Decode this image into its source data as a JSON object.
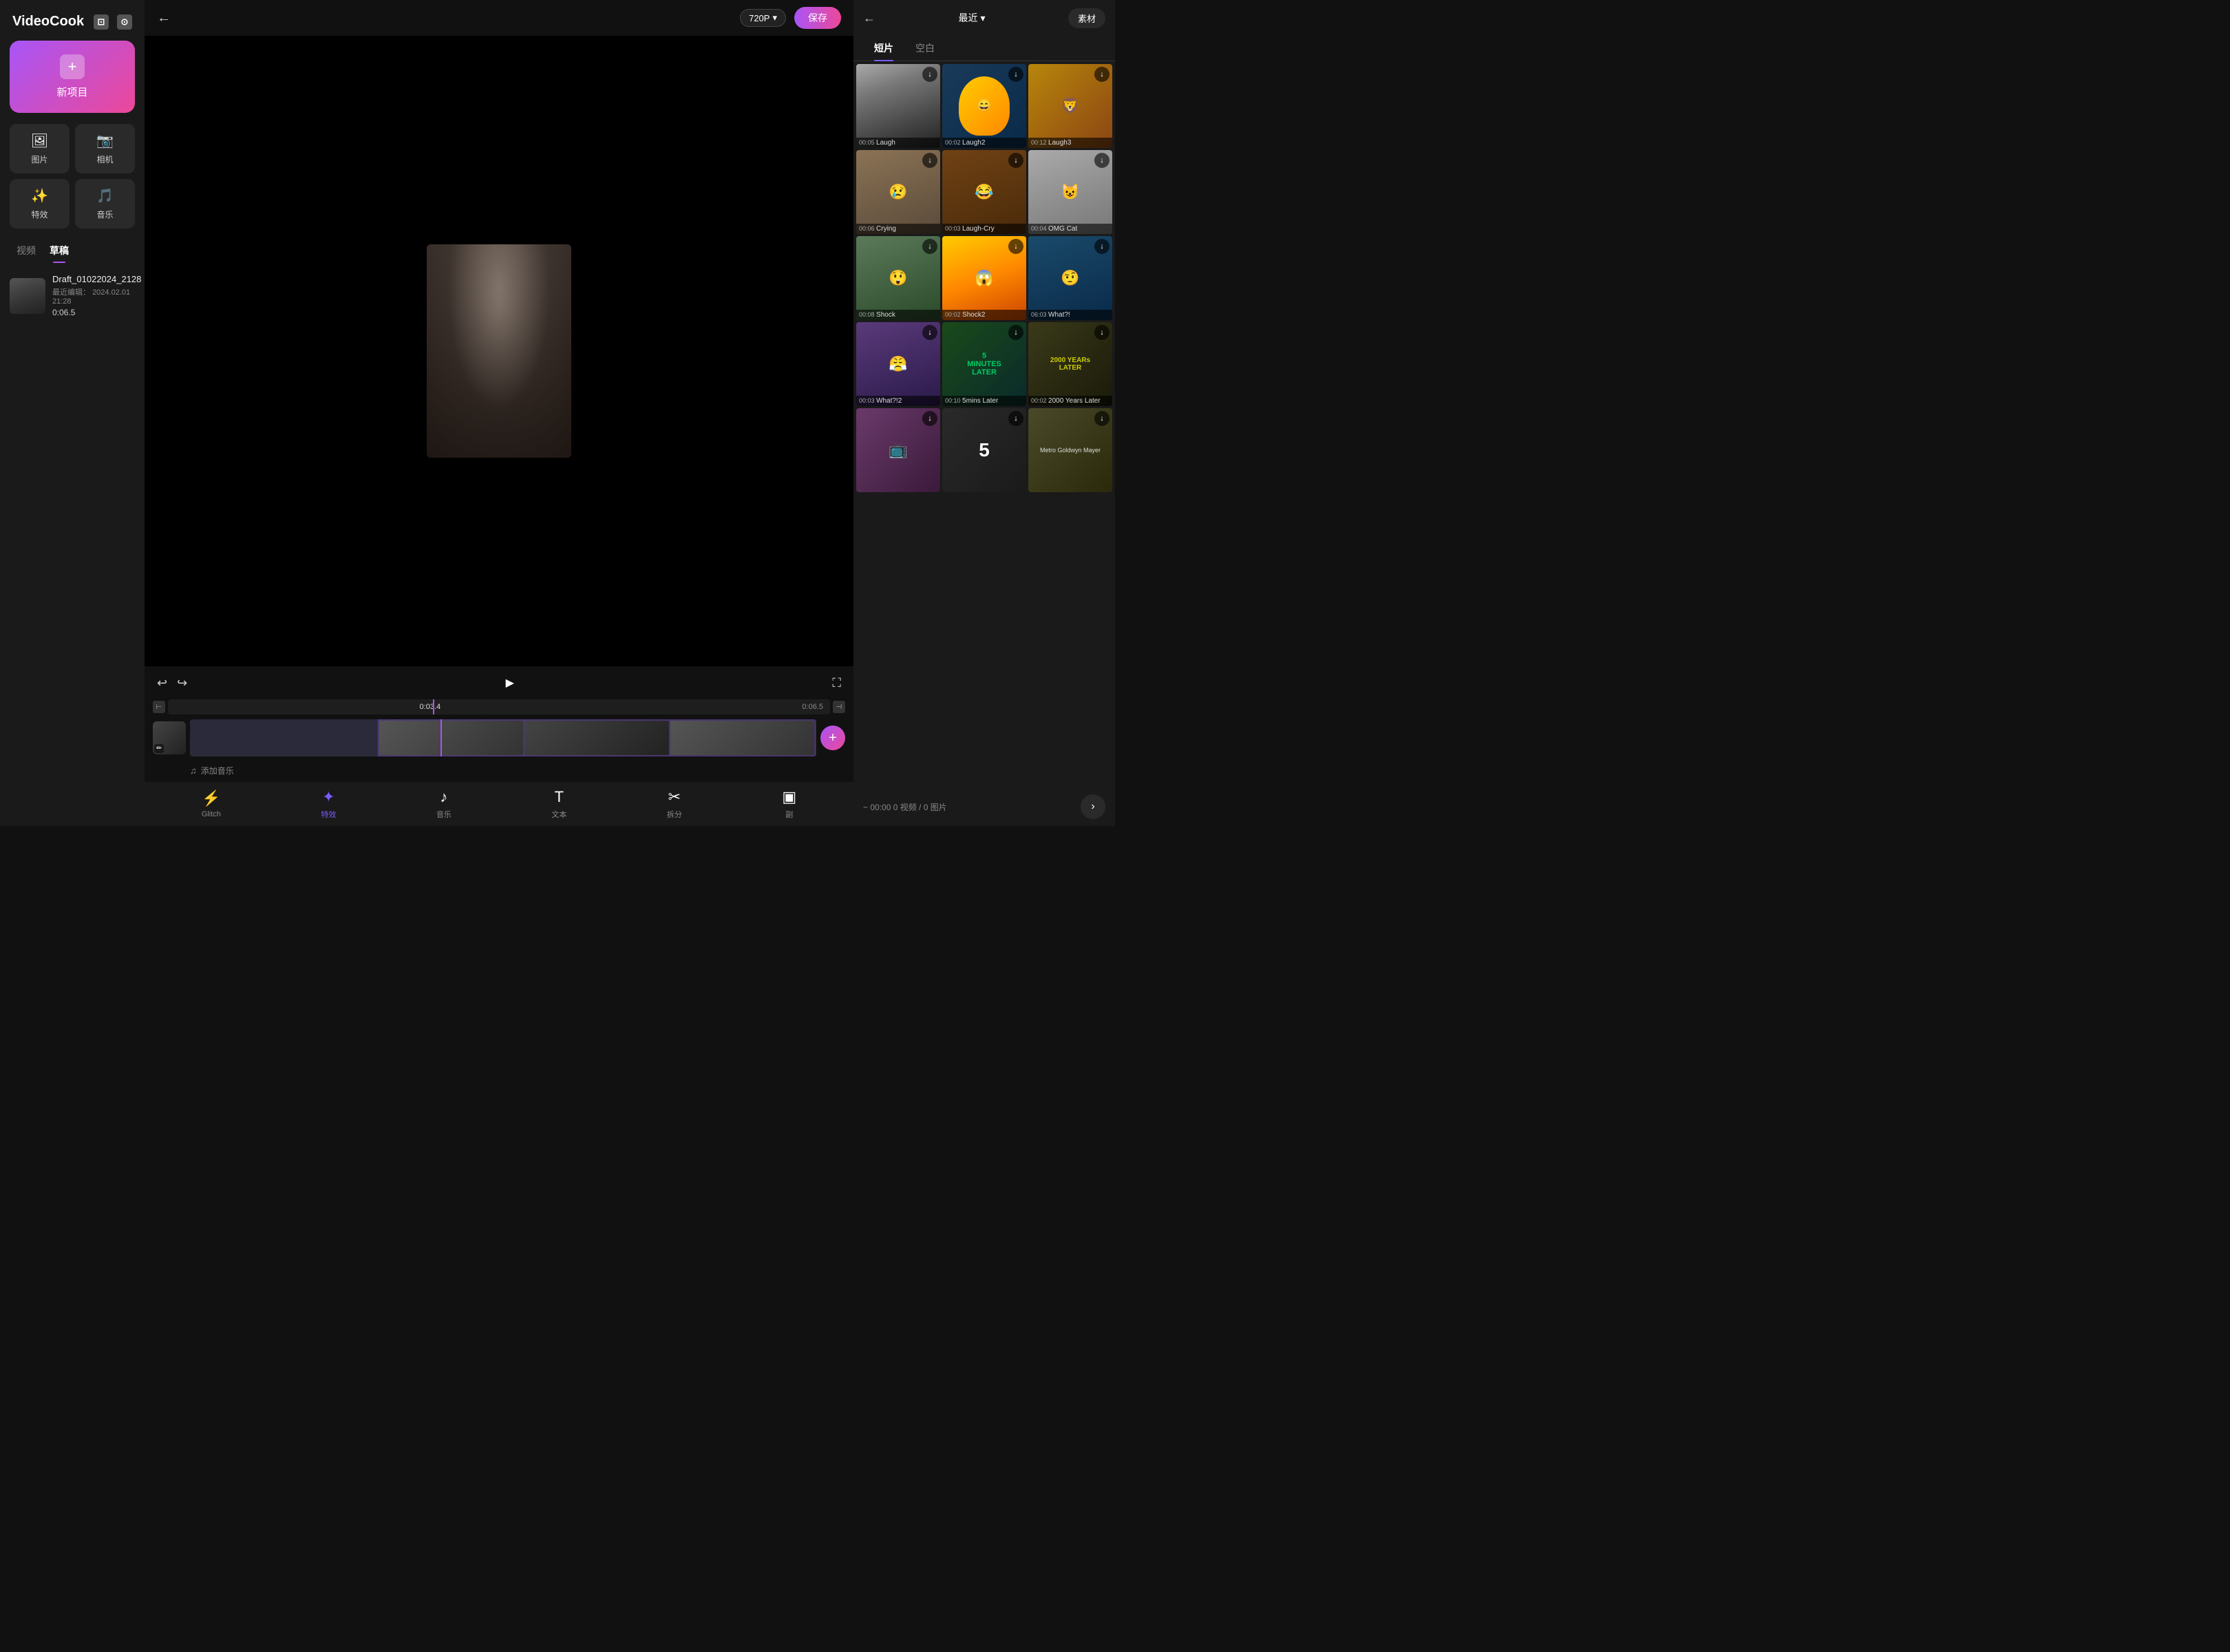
{
  "app": {
    "name": "VideoCook"
  },
  "sidebar": {
    "logo": "VideoCook",
    "icons": [
      "tv-icon",
      "camera-icon"
    ],
    "new_project_label": "新项目",
    "quick_actions": [
      {
        "icon": "🖼",
        "label": "图片"
      },
      {
        "icon": "📷",
        "label": "相机"
      },
      {
        "icon": "✨",
        "label": "特效"
      },
      {
        "icon": "🎵",
        "label": "音乐"
      }
    ],
    "tabs": [
      {
        "label": "视频",
        "active": false
      },
      {
        "label": "草稿",
        "active": true
      }
    ],
    "draft": {
      "title": "Draft_01022024_2128",
      "date_label": "最近编辑：",
      "date": "2024.02.01 21:28",
      "duration": "0:06.5"
    }
  },
  "topbar": {
    "quality": "720P",
    "quality_dropdown_icon": "▾",
    "save_label": "保存"
  },
  "player": {
    "undo_icon": "↩",
    "redo_icon": "↪",
    "play_icon": "▶",
    "fullscreen_icon": "⛶"
  },
  "timeline": {
    "start_icon": "⊢",
    "end_icon": "⊣",
    "current_time": "0:03.4",
    "total_time": "0:06.5",
    "add_btn": "+",
    "music_label": "添加音乐"
  },
  "toolbar": {
    "items": [
      {
        "icon": "⚡",
        "label": "Glitch",
        "active": false
      },
      {
        "icon": "✦",
        "label": "特效",
        "active": true
      },
      {
        "icon": "♪",
        "label": "音乐",
        "active": false
      },
      {
        "icon": "T",
        "label": "文本",
        "active": false
      },
      {
        "icon": "✂",
        "label": "拆分",
        "active": false
      },
      {
        "icon": "▣",
        "label": "副",
        "active": false
      }
    ]
  },
  "right_panel": {
    "back_icon": "←",
    "recent_label": "最近",
    "recent_dropdown": "▾",
    "material_btn": "素材",
    "tabs": [
      {
        "label": "短片",
        "active": true
      },
      {
        "label": "空白",
        "active": false
      }
    ],
    "media_items": [
      {
        "id": "laugh",
        "duration": "00:05",
        "title": "Laugh",
        "bg": "bg-laugh"
      },
      {
        "id": "laugh2",
        "duration": "00:02",
        "title": "Laugh2",
        "bg": "bg-laugh2"
      },
      {
        "id": "laugh3",
        "duration": "00:12",
        "title": "Laugh3",
        "bg": "bg-laugh3"
      },
      {
        "id": "crying",
        "duration": "00:06",
        "title": "Crying",
        "bg": "bg-cry"
      },
      {
        "id": "laughcry",
        "duration": "00:03",
        "title": "Laugh-Cry",
        "bg": "bg-laughcry"
      },
      {
        "id": "omgcat",
        "duration": "00:04",
        "title": "OMG Cat",
        "bg": "bg-omgcat"
      },
      {
        "id": "shock",
        "duration": "00:08",
        "title": "Shock",
        "bg": "bg-shock"
      },
      {
        "id": "shock2",
        "duration": "00:02",
        "title": "Shock2",
        "bg": "bg-shock2"
      },
      {
        "id": "what",
        "duration": "06:03",
        "title": "What?!",
        "bg": "bg-what"
      },
      {
        "id": "what2",
        "duration": "00:03",
        "title": "What?!2",
        "bg": "bg-what2"
      },
      {
        "id": "5mins",
        "duration": "00:10",
        "title": "5mins Later",
        "bg": "bg-5mins"
      },
      {
        "id": "2000",
        "duration": "00:02",
        "title": "2000 Years Later",
        "bg": "bg-2000"
      },
      {
        "id": "sponge2",
        "duration": "",
        "title": "",
        "bg": "bg-sponge2"
      },
      {
        "id": "five",
        "duration": "",
        "title": "",
        "bg": "bg-five"
      },
      {
        "id": "metro",
        "duration": "",
        "title": "",
        "bg": "bg-metro"
      }
    ],
    "footer": {
      "info": "~ 00:00  0 视频 / 0 图片",
      "next_icon": "›"
    }
  }
}
